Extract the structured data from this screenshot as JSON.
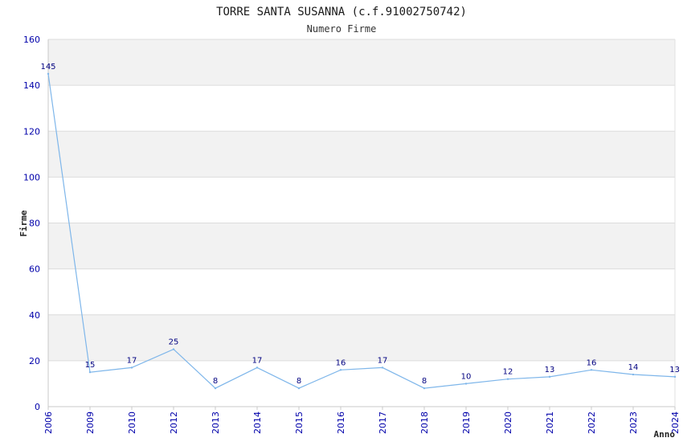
{
  "chart_data": {
    "type": "line",
    "title": "TORRE SANTA SUSANNA (c.f.91002750742)",
    "subtitle": "Numero Firme",
    "xlabel": "Anno",
    "ylabel": "Firme",
    "ylim": [
      0,
      160
    ],
    "yticks": [
      0,
      20,
      40,
      60,
      80,
      100,
      120,
      140,
      160
    ],
    "categories": [
      "2006",
      "2009",
      "2010",
      "2012",
      "2013",
      "2014",
      "2015",
      "2016",
      "2017",
      "2018",
      "2019",
      "2020",
      "2021",
      "2022",
      "2023",
      "2024"
    ],
    "values": [
      145,
      15,
      17,
      25,
      8,
      17,
      8,
      16,
      17,
      8,
      10,
      12,
      13,
      16,
      14,
      13
    ],
    "grid": true,
    "colors": {
      "line": "#7eb6ea",
      "band": "#f2f2f2",
      "grid": "#dcdcdc",
      "tick_text": "#0000aa",
      "label_text": "#000080",
      "title_text": "#1a1a1a"
    }
  }
}
